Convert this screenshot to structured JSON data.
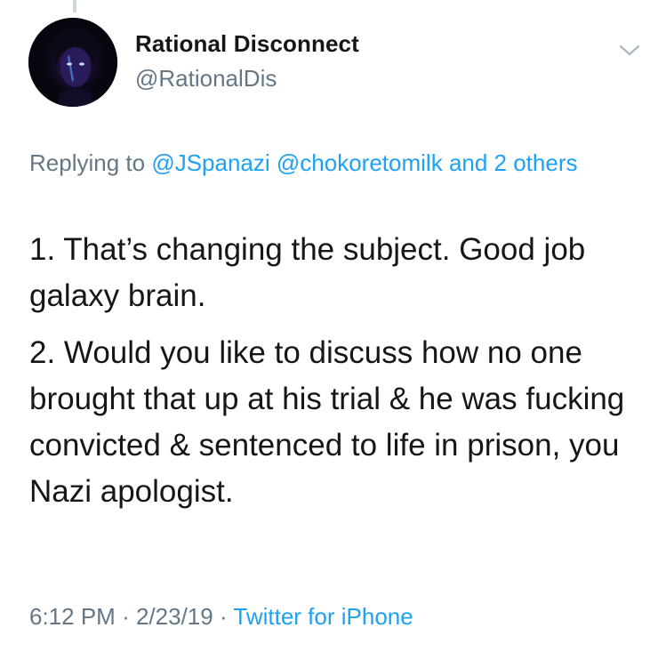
{
  "tweet": {
    "author": {
      "name": "Rational Disconnect",
      "handle": "@RationalDis"
    },
    "replying": {
      "prefix": "Replying to",
      "user1": "@JSpanazi",
      "user2": "@chokoretomilk",
      "and_others": "and 2 others"
    },
    "paragraphs": [
      "1. That’s changing the subject. Good job galaxy brain.",
      "2. Would you like to discuss how no one brought that up at his trial & he was fucking convicted & sentenced to life in prison, you Nazi apologist."
    ],
    "time": "6:12 PM",
    "separator": "·",
    "date": "2/23/19",
    "source": "Twitter for iPhone"
  },
  "icons": {
    "menu": "chevron-down-icon",
    "avatar": "avatar-photo"
  },
  "colors": {
    "link": "#1da1f2",
    "secondary_text": "#657786",
    "primary_text": "#14171a",
    "thread_line": "#ccd6dd"
  }
}
